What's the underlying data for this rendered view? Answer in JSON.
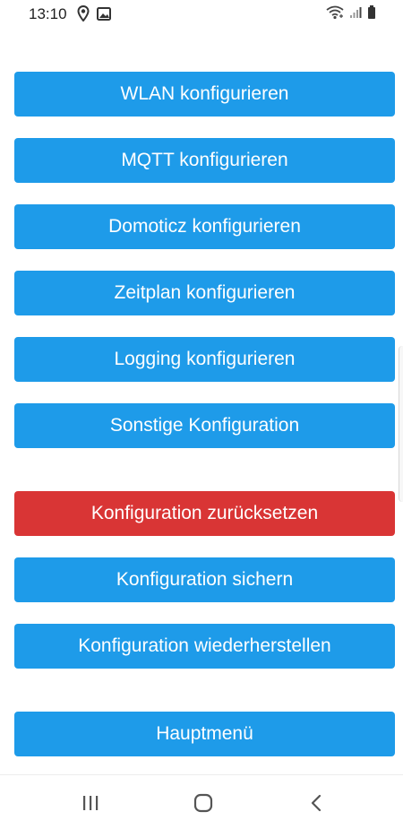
{
  "status_bar": {
    "time": "13:10",
    "left_icons": [
      "location-icon",
      "image-icon"
    ],
    "right_icons": [
      "wifi-icon",
      "signal-icon",
      "battery-icon"
    ]
  },
  "menu": {
    "buttons": [
      {
        "label": "WLAN konfigurieren"
      },
      {
        "label": "MQTT konfigurieren"
      },
      {
        "label": "Domoticz konfigurieren"
      },
      {
        "label": "Zeitplan konfigurieren"
      },
      {
        "label": "Logging konfigurieren"
      },
      {
        "label": "Sonstige Konfiguration"
      },
      {
        "label": "Konfiguration zurücksetzen"
      },
      {
        "label": "Konfiguration sichern"
      },
      {
        "label": "Konfiguration wiederherstellen"
      },
      {
        "label": "Hauptmenü"
      }
    ]
  },
  "colors": {
    "primary": "#1e9be9",
    "danger": "#d93535",
    "background": "#ffffff"
  },
  "nav_bar": {
    "icons": [
      "recent-apps-icon",
      "home-icon",
      "back-icon"
    ]
  }
}
